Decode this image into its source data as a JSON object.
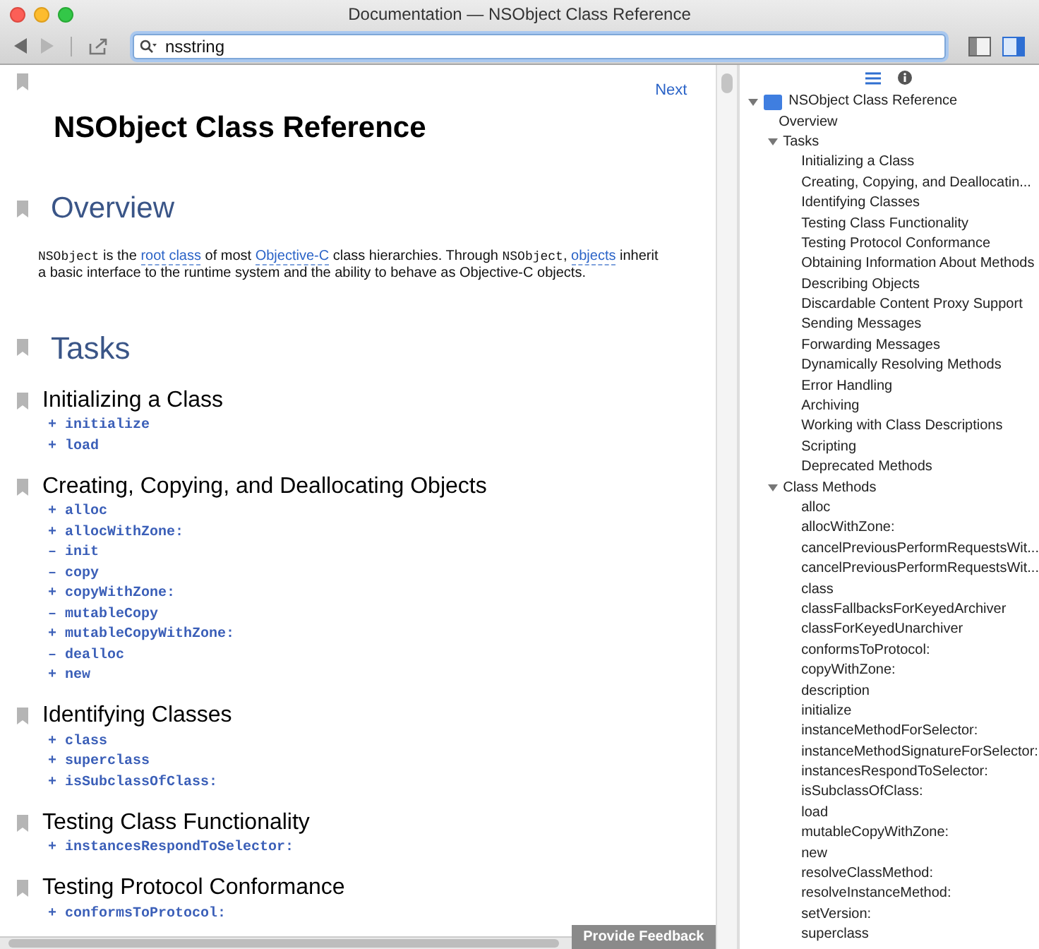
{
  "window": {
    "title": "Documentation — NSObject Class Reference"
  },
  "toolbar": {
    "search_value": "nsstring",
    "view_toggles": [
      {
        "selected": false
      },
      {
        "selected": true
      }
    ]
  },
  "content": {
    "next_link": "Next",
    "title": "NSObject Class Reference",
    "overview": {
      "heading": "Overview",
      "paragraph": [
        {
          "kind": "code",
          "text": "NSObject"
        },
        {
          "kind": "text",
          "text": " is the "
        },
        {
          "kind": "link",
          "text": "root class"
        },
        {
          "kind": "text",
          "text": " of most "
        },
        {
          "kind": "link",
          "text": "Objective-C"
        },
        {
          "kind": "text",
          "text": " class hierarchies. Through "
        },
        {
          "kind": "code",
          "text": "NSObject"
        },
        {
          "kind": "text",
          "text": ", "
        },
        {
          "kind": "link",
          "text": "objects"
        },
        {
          "kind": "text",
          "text": " inherit a basic interface to the runtime system and the ability to behave as Objective-C objects."
        }
      ]
    },
    "tasks_heading": "Tasks",
    "sections": [
      {
        "heading": "Initializing a Class",
        "methods": [
          {
            "sign": "+",
            "name": "initialize"
          },
          {
            "sign": "+",
            "name": "load"
          }
        ]
      },
      {
        "heading": "Creating, Copying, and Deallocating Objects",
        "methods": [
          {
            "sign": "+",
            "name": "alloc"
          },
          {
            "sign": "+",
            "name": "allocWithZone:"
          },
          {
            "sign": "–",
            "name": "init"
          },
          {
            "sign": "–",
            "name": "copy"
          },
          {
            "sign": "+",
            "name": "copyWithZone:"
          },
          {
            "sign": "–",
            "name": "mutableCopy"
          },
          {
            "sign": "+",
            "name": "mutableCopyWithZone:"
          },
          {
            "sign": "–",
            "name": "dealloc"
          },
          {
            "sign": "+",
            "name": "new"
          }
        ]
      },
      {
        "heading": "Identifying Classes",
        "methods": [
          {
            "sign": "+",
            "name": "class"
          },
          {
            "sign": "+",
            "name": "superclass"
          },
          {
            "sign": "+",
            "name": "isSubclassOfClass:"
          }
        ]
      },
      {
        "heading": "Testing Class Functionality",
        "methods": [
          {
            "sign": "+",
            "name": "instancesRespondToSelector:"
          }
        ]
      },
      {
        "heading": "Testing Protocol Conformance",
        "methods": [
          {
            "sign": "+",
            "name": "conformsToProtocol:"
          }
        ]
      }
    ],
    "feedback_button": "Provide Feedback"
  },
  "sidebar": {
    "tabs": [
      {
        "kind": "list",
        "selected": true
      },
      {
        "kind": "info",
        "selected": false
      }
    ],
    "tree": [
      {
        "label": "NSObject Class Reference",
        "expanded": true,
        "children": [
          {
            "label": "Overview"
          },
          {
            "label": "Tasks",
            "expanded": true,
            "children": [
              {
                "label": "Initializing a Class"
              },
              {
                "label": "Creating, Copying, and Deallocatin..."
              },
              {
                "label": "Identifying Classes"
              },
              {
                "label": "Testing Class Functionality"
              },
              {
                "label": "Testing Protocol Conformance"
              },
              {
                "label": "Obtaining Information About Methods"
              },
              {
                "label": "Describing Objects"
              },
              {
                "label": "Discardable Content Proxy Support"
              },
              {
                "label": "Sending Messages"
              },
              {
                "label": "Forwarding Messages"
              },
              {
                "label": "Dynamically Resolving Methods"
              },
              {
                "label": "Error Handling"
              },
              {
                "label": "Archiving"
              },
              {
                "label": "Working with Class Descriptions"
              },
              {
                "label": "Scripting"
              },
              {
                "label": "Deprecated Methods"
              }
            ]
          },
          {
            "label": "Class Methods",
            "expanded": true,
            "children": [
              {
                "label": "alloc"
              },
              {
                "label": "allocWithZone:"
              },
              {
                "label": "cancelPreviousPerformRequestsWit..."
              },
              {
                "label": "cancelPreviousPerformRequestsWit..."
              },
              {
                "label": "class"
              },
              {
                "label": "classFallbacksForKeyedArchiver"
              },
              {
                "label": "classForKeyedUnarchiver"
              },
              {
                "label": "conformsToProtocol:"
              },
              {
                "label": "copyWithZone:"
              },
              {
                "label": "description"
              },
              {
                "label": "initialize"
              },
              {
                "label": "instanceMethodForSelector:"
              },
              {
                "label": "instanceMethodSignatureForSelector:"
              },
              {
                "label": "instancesRespondToSelector:"
              },
              {
                "label": "isSubclassOfClass:"
              },
              {
                "label": "load"
              },
              {
                "label": "mutableCopyWithZone:"
              },
              {
                "label": "new"
              },
              {
                "label": "resolveClassMethod:"
              },
              {
                "label": "resolveInstanceMethod:"
              },
              {
                "label": "setVersion:"
              },
              {
                "label": "superclass"
              }
            ]
          }
        ]
      }
    ]
  }
}
